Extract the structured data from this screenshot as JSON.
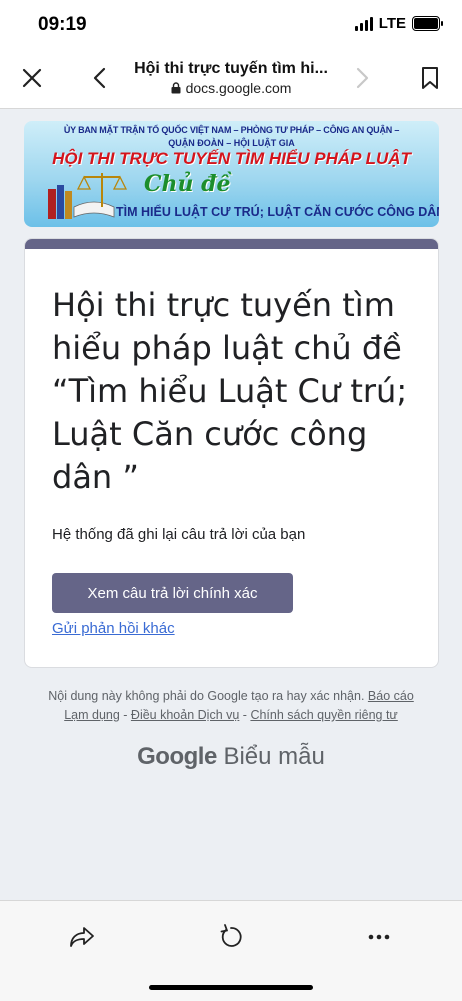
{
  "status": {
    "time": "09:19",
    "network": "LTE"
  },
  "nav": {
    "title": "Hội thi trực tuyến tìm hi...",
    "url": "docs.google.com"
  },
  "banner": {
    "line1": "ỦY BAN MẶT TRẬN TỔ QUỐC VIỆT NAM – PHÒNG TƯ PHÁP – CÔNG AN QUẬN –",
    "line2": "QUẬN ĐOÀN – HỘI LUẬT GIA",
    "title": "HỘI THI TRỰC TUYẾN TÌM HIỂU PHÁP LUẬT",
    "theme_label": "Chủ đề",
    "subtitle": "TÌM HIỂU LUẬT CƯ TRÚ; LUẬT CĂN CƯỚC CÔNG DÂN"
  },
  "form": {
    "title": "Hội thi trực tuyến tìm hiểu pháp luật chủ đề “Tìm hiểu Luật Cư trú; Luật Căn cước công dân ”",
    "confirmation": "Hệ thống đã ghi lại câu trả lời của bạn",
    "view_answers_label": "Xem câu trả lời chính xác",
    "another_response_label": "Gửi phản hồi khác"
  },
  "footer": {
    "disclaimer": "Nội dung này không phải do Google tạo ra hay xác nhận.",
    "report_abuse": "Báo cáo Lạm dụng",
    "sep1": " - ",
    "terms": "Điều khoản Dịch vụ",
    "sep2": " - ",
    "privacy": "Chính sách quyền riêng tư"
  },
  "branding": {
    "google": "Google",
    "forms": "Biểu mẫu"
  },
  "colors": {
    "accent": "#656588",
    "link": "#3a6bd4",
    "background": "#eceff3"
  }
}
